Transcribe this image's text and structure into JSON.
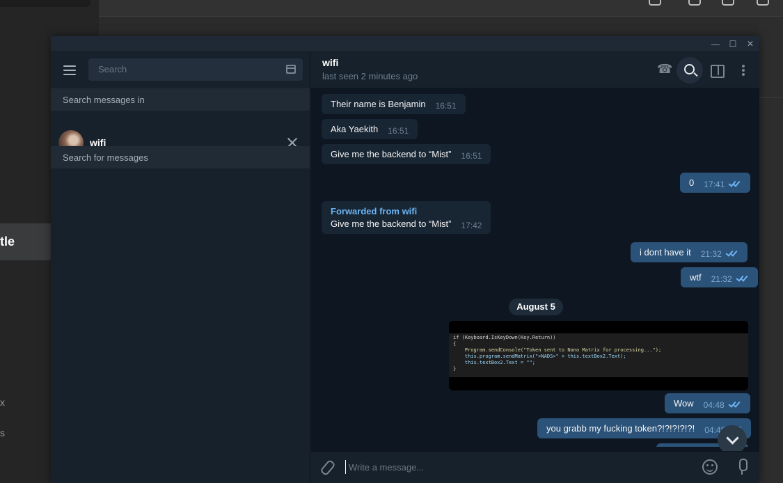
{
  "background": {
    "selected_fragment": "tle",
    "letters": [
      "x",
      "s"
    ]
  },
  "window": {
    "controls": {
      "minimize": "—",
      "maximize": "☐",
      "close": "✕"
    }
  },
  "left_panel": {
    "search_placeholder": "Search",
    "search_in_label": "Search messages in",
    "scope_chat_name": "wifi",
    "search_for_label": "Search for messages"
  },
  "chat_header": {
    "title": "wifi",
    "status": "last seen 2 minutes ago",
    "icons": [
      "phone-icon",
      "search-icon",
      "sidebar-panel-icon",
      "more-icon"
    ]
  },
  "messages": [
    {
      "dir": "in",
      "text": "Their name is Benjamin",
      "time": "16:51"
    },
    {
      "dir": "in",
      "text": "Aka Yaekith",
      "time": "16:51"
    },
    {
      "dir": "in",
      "text": "Give me the backend to “Mist”",
      "time": "16:51"
    },
    {
      "dir": "out",
      "text": "0",
      "time": "17:41"
    },
    {
      "dir": "in",
      "forwarded_from": "Forwarded from wifi",
      "text": "Give me the backend to “Mist”",
      "time": "17:42"
    },
    {
      "dir": "out",
      "text": "i dont have it",
      "time": "21:32"
    },
    {
      "dir": "out",
      "text": "wtf",
      "time": "21:32"
    },
    {
      "dir": "out",
      "text": "Wow",
      "time": "04:48"
    },
    {
      "dir": "out",
      "text": "you grabb my fucking token?!?!?!?!?!",
      "time": "04:48"
    }
  ],
  "date_separator": "August 5",
  "code_image": {
    "line1": "if (Keyboard.IsKeyDown(Key.Return))",
    "line2": "{",
    "line3": "    Program.sendConsole(\"Token sent to Nano Matrix for processing...\");",
    "line4": "    this.program.sendMatrix(\">NADS>\" + this.textBox2.Text);",
    "line5": "    this.textBox2.Text = \"\";",
    "line6": "}"
  },
  "composer": {
    "placeholder": "Write a message..."
  },
  "colors": {
    "sidebar_bg": "#17212b",
    "chat_bg": "#0e1621",
    "incoming_bubble": "#182533",
    "outgoing_bubble": "#2b5278",
    "accent": "#6ab3f3"
  }
}
